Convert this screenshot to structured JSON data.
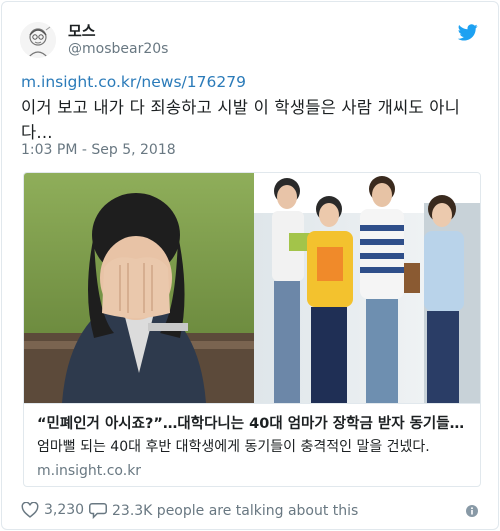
{
  "user": {
    "display_name": "모스",
    "handle": "@mosbear20s"
  },
  "tweet": {
    "link": "m.insight.co.kr/news/176279",
    "text": "이거 보고 내가 다 죄송하고 시발 이 학생들은 사람 개씨도 아니다...",
    "timestamp": "1:03 PM - Sep 5, 2018"
  },
  "card": {
    "title": "“민폐인거 아시죠?”…대학다니는 40대 엄마가 장학금 받자 동기들…",
    "description": "엄마뻘 되는 40대 후반 대학생에게 동기들이 충격적인 말을 건넸다.",
    "domain": "m.insight.co.kr"
  },
  "footer": {
    "likes": "3,230",
    "talking": "23.3K people are talking about this"
  },
  "icons": {
    "brand": "twitter-bird-icon",
    "like": "heart-icon",
    "reply": "speech-bubble-icon",
    "info": "info-icon"
  },
  "colors": {
    "twitter_blue": "#1da1f2",
    "link_blue": "#2b7bb9",
    "muted_gray": "#697882",
    "border": "#e1e8ed"
  }
}
